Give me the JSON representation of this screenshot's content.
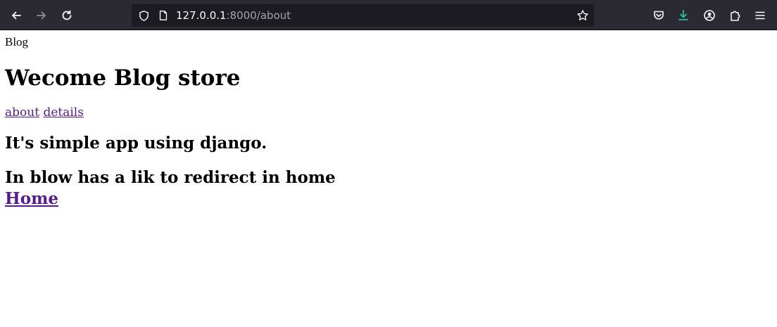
{
  "browser": {
    "url_host": "127.0.0.1",
    "url_path": ":8000/about",
    "icons": [
      "back-arrow-icon",
      "forward-arrow-icon",
      "reload-icon",
      "shield-icon",
      "page-icon",
      "bookmark-star-icon",
      "pocket-icon",
      "download-icon",
      "account-icon",
      "extensions-icon",
      "menu-icon"
    ],
    "colors": {
      "toolbar": "#2b2a33",
      "urlbar": "#1c1b22",
      "download_accent": "#2ac3a2"
    }
  },
  "page": {
    "brand": "Blog",
    "title": "Wecome Blog store",
    "nav_links": [
      {
        "label": "about"
      },
      {
        "label": "details"
      }
    ],
    "heading_1": "It's simple app using django.",
    "heading_2": "In blow has a lik to redirect in home",
    "home_link": "Home",
    "link_color": "#551a8b"
  }
}
